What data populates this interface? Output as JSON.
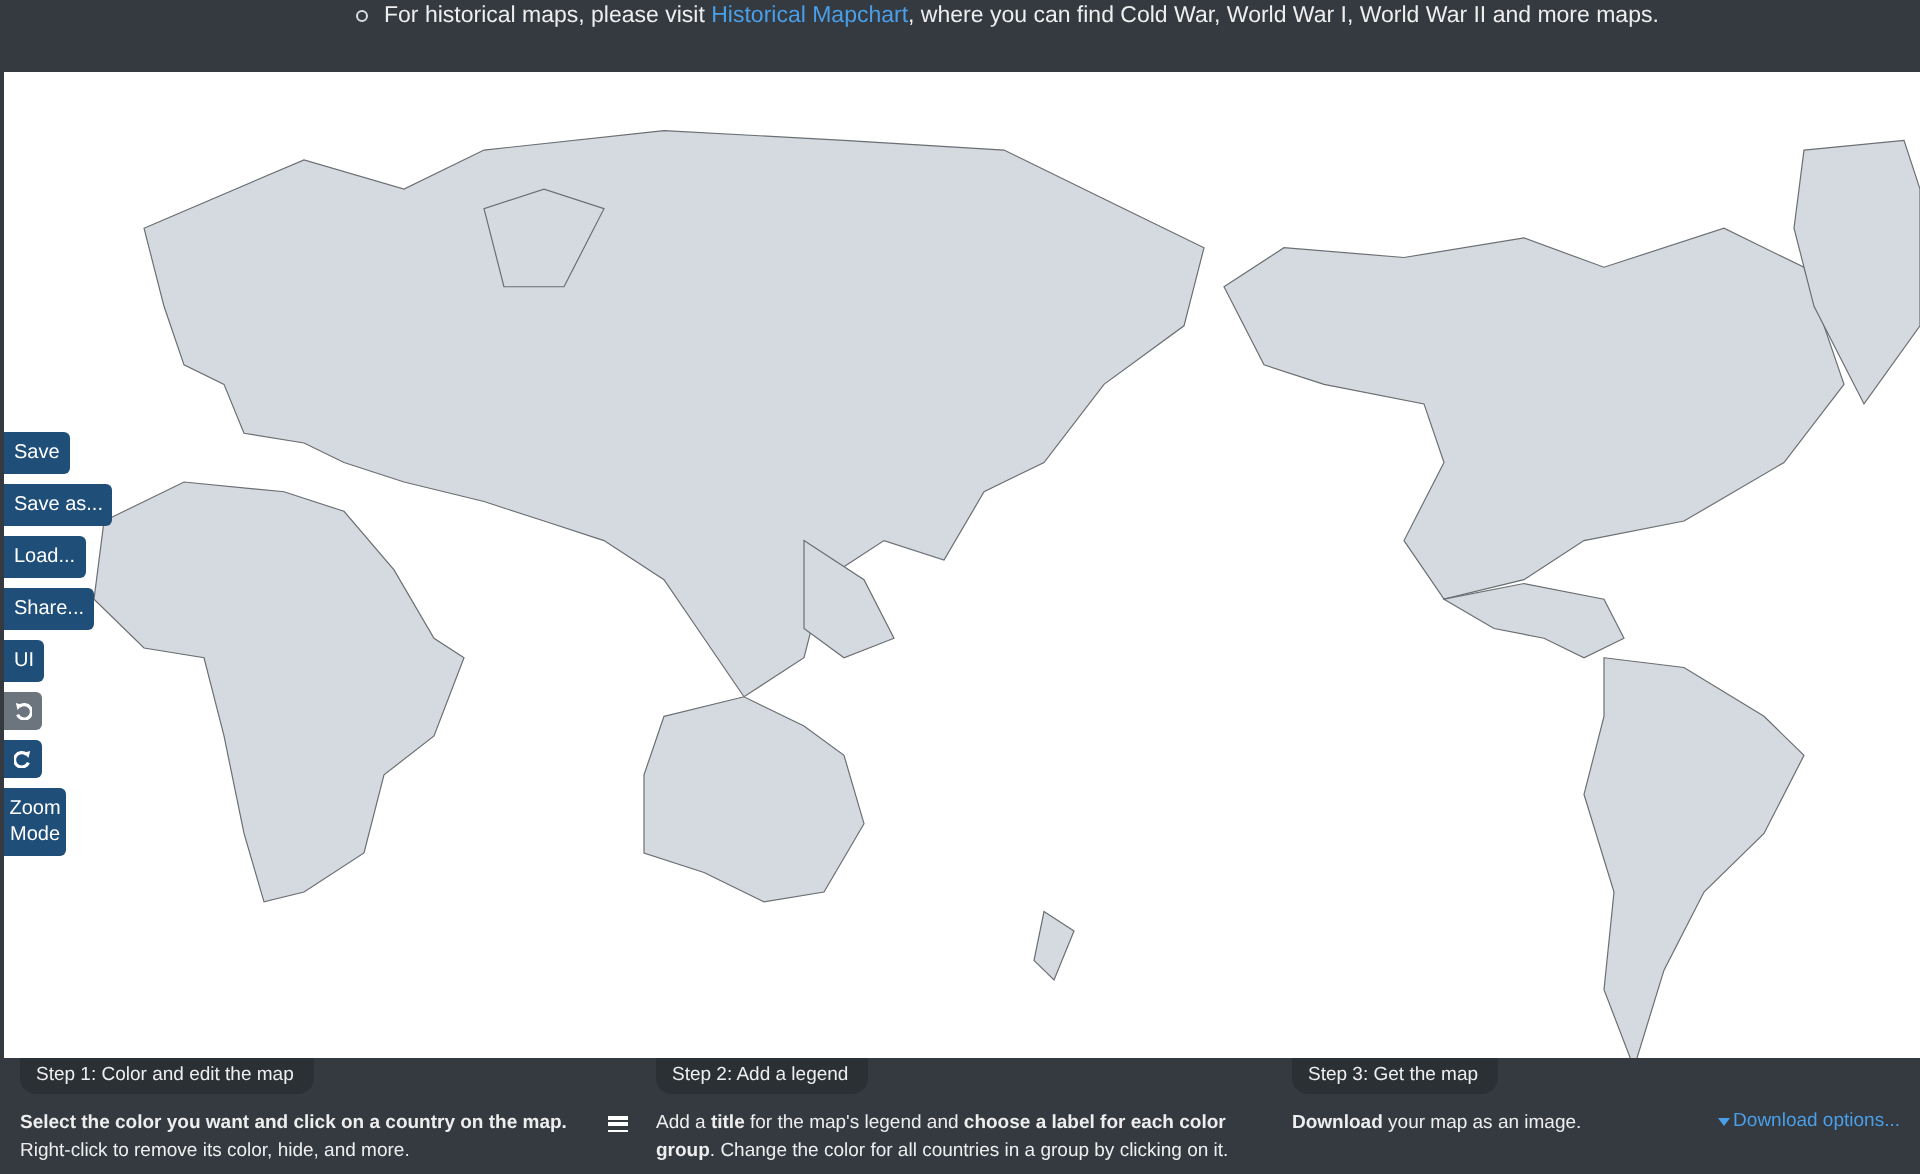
{
  "notice": {
    "before": "For historical maps, please visit ",
    "link": "Historical Mapchart",
    "after": ", where you can find Cold War, World War I, World War II and more maps."
  },
  "toolbar": [
    {
      "kind": "text",
      "label": "Save",
      "disabled": false
    },
    {
      "kind": "text",
      "label": "Save as...",
      "disabled": false
    },
    {
      "kind": "text",
      "label": "Load...",
      "disabled": false
    },
    {
      "kind": "text",
      "label": "Share...",
      "disabled": false
    },
    {
      "kind": "text",
      "label": "UI",
      "disabled": false
    },
    {
      "kind": "undo",
      "disabled": true
    },
    {
      "kind": "redo",
      "disabled": false
    },
    {
      "kind": "text",
      "label": "Zoom Mode",
      "disabled": false
    }
  ],
  "steps": [
    {
      "title": "Step 1: Color and edit the map",
      "text": "**Select the color you want and click on a country on the map.** Right-click to remove its color, hide, and more.",
      "action": {
        "kind": "menu"
      }
    },
    {
      "title": "Step 2: Add a legend",
      "text": "Add a **title** for the map's legend and **choose a label for each color group**. Change the color for all countries in a group by clicking on it.",
      "action": {
        "kind": "none"
      }
    },
    {
      "title": "Step 3: Get the map",
      "text": "**Download** your map as an image.",
      "action": {
        "kind": "link",
        "label": "Download options..."
      }
    }
  ]
}
